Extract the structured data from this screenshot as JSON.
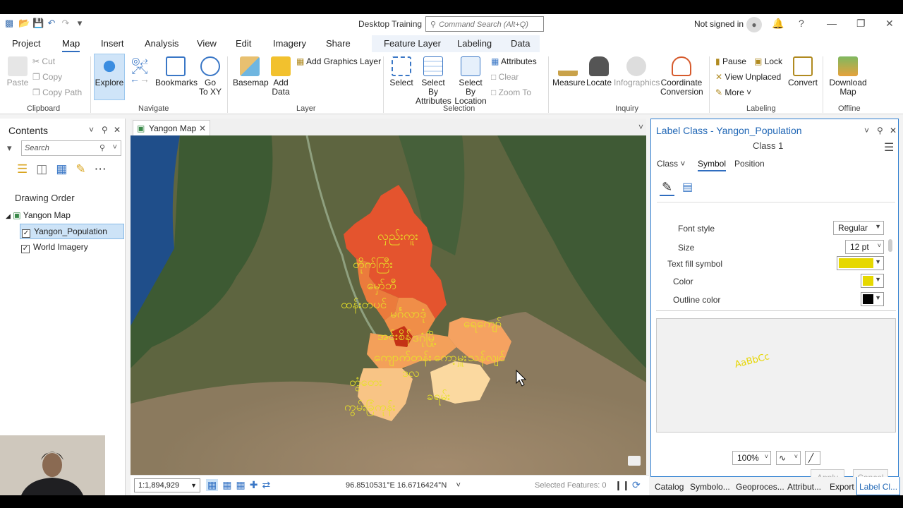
{
  "titlebar": {
    "title": "Desktop Training",
    "command_search": "Command Search (Alt+Q)",
    "signin": "Not signed in"
  },
  "tabs": [
    "Project",
    "Map",
    "Insert",
    "Analysis",
    "View",
    "Edit",
    "Imagery",
    "Share"
  ],
  "active_tab": "Map",
  "context_tabs": [
    "Feature Layer",
    "Labeling",
    "Data"
  ],
  "ribbon": {
    "clipboard": {
      "label": "Clipboard",
      "paste": "Paste",
      "cut": "Cut",
      "copy": "Copy",
      "copy_path": "Copy Path"
    },
    "navigate": {
      "label": "Navigate",
      "explore": "Explore",
      "bookmarks": "Bookmarks",
      "goto_l1": "Go",
      "goto_l2": "To XY"
    },
    "layer": {
      "label": "Layer",
      "basemap": "Basemap",
      "add_data_l1": "Add",
      "add_data_l2": "Data",
      "add_graphics": "Add Graphics Layer"
    },
    "selection": {
      "label": "Selection",
      "select": "Select",
      "by_attr_l1": "Select By",
      "by_attr_l2": "Attributes",
      "by_loc_l1": "Select By",
      "by_loc_l2": "Location",
      "attributes": "Attributes",
      "clear": "Clear",
      "zoom_to": "Zoom To"
    },
    "inquiry": {
      "label": "Inquiry",
      "measure": "Measure",
      "locate": "Locate",
      "infographics": "Infographics",
      "coord_l1": "Coordinate",
      "coord_l2": "Conversion"
    },
    "labeling": {
      "label": "Labeling",
      "pause": "Pause",
      "lock": "Lock",
      "view_unplaced": "View Unplaced",
      "more": "More",
      "convert": "Convert"
    },
    "offline": {
      "label": "Offline",
      "download_l1": "Download",
      "download_l2": "Map"
    }
  },
  "contents": {
    "title": "Contents",
    "search_placeholder": "Search",
    "drawing_order": "Drawing Order",
    "map_name": "Yangon Map",
    "layers": [
      "Yangon_Population",
      "World Imagery"
    ]
  },
  "map": {
    "tab_name": "Yangon Map",
    "scale": "1:1,894,929",
    "coordinates": "96.8510531°E 16.6716424°N",
    "selected_features": "Selected Features: 0",
    "labels": [
      "လှည်းကူး",
      "တိုက်ကြီး",
      "မှော်ဘီ",
      "ထန်းတပင်",
      "မင်္ဂလာဒုံ",
      "ရေကျော်",
      "အင်းစိန်",
      "ဒဂုံမြို့",
      "ကျောက်တန်း",
      "ကော့မှူး",
      "သန်လျင်",
      "တွံတေး",
      "ဒလ",
      "ကွမ်းခြံကုန်း",
      "ခရမ်း"
    ]
  },
  "label_pane": {
    "title": "Label Class -  Yangon_Population",
    "class_name": "Class 1",
    "tabs": [
      "Class",
      "Symbol",
      "Position"
    ],
    "font_style_label": "Font style",
    "font_style": "Regular",
    "size_label": "Size",
    "size": "12 pt",
    "text_fill_label": "Text fill symbol",
    "color_label": "Color",
    "outline_label": "Outline color",
    "text_fill_color": "#e6d800",
    "color_value": "#e6d800",
    "outline_value": "#000000",
    "preview_text": "AaBbCc",
    "zoom": "100%",
    "apply": "Apply",
    "cancel": "Cancel"
  },
  "dock_tabs": [
    "Catalog",
    "Symbolo...",
    "Geoproces...",
    "Attribut...",
    "Export",
    "Label Cl..."
  ]
}
